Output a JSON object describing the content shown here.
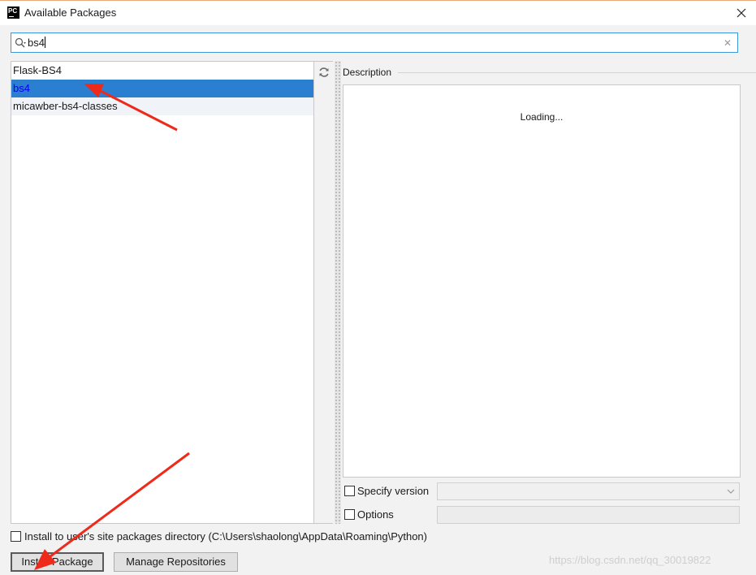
{
  "window": {
    "icon_text": "PC",
    "title": "Available Packages",
    "close_icon": "close-icon"
  },
  "search": {
    "value": "bs4",
    "icon": "search-icon",
    "clear_icon": "clear-icon",
    "clear_glyph": "✕"
  },
  "packages": [
    {
      "name": "Flask-BS4",
      "selected": false
    },
    {
      "name": "bs4",
      "selected": true
    },
    {
      "name": "micawber-bs4-classes",
      "selected": false
    }
  ],
  "toolbar": {
    "refresh_icon": "refresh-icon"
  },
  "description": {
    "label": "Description",
    "loading_text": "Loading..."
  },
  "options": {
    "specify_version_label": "Specify version",
    "specify_version_checked": false,
    "version_value": "",
    "options_label": "Options",
    "options_checked": false,
    "options_value": "",
    "install_to_user_label": "Install to user's site packages directory (C:\\Users\\shaolong\\AppData\\Roaming\\Python)",
    "install_to_user_checked": false
  },
  "buttons": {
    "install_label": "Install Package",
    "manage_label": "Manage Repositories"
  },
  "watermark": "https://blog.csdn.net/qq_30019822",
  "colors": {
    "selection": "#2a7fd0",
    "focus_border": "#3d97d8",
    "annotation_arrow": "#ee2a1b"
  }
}
